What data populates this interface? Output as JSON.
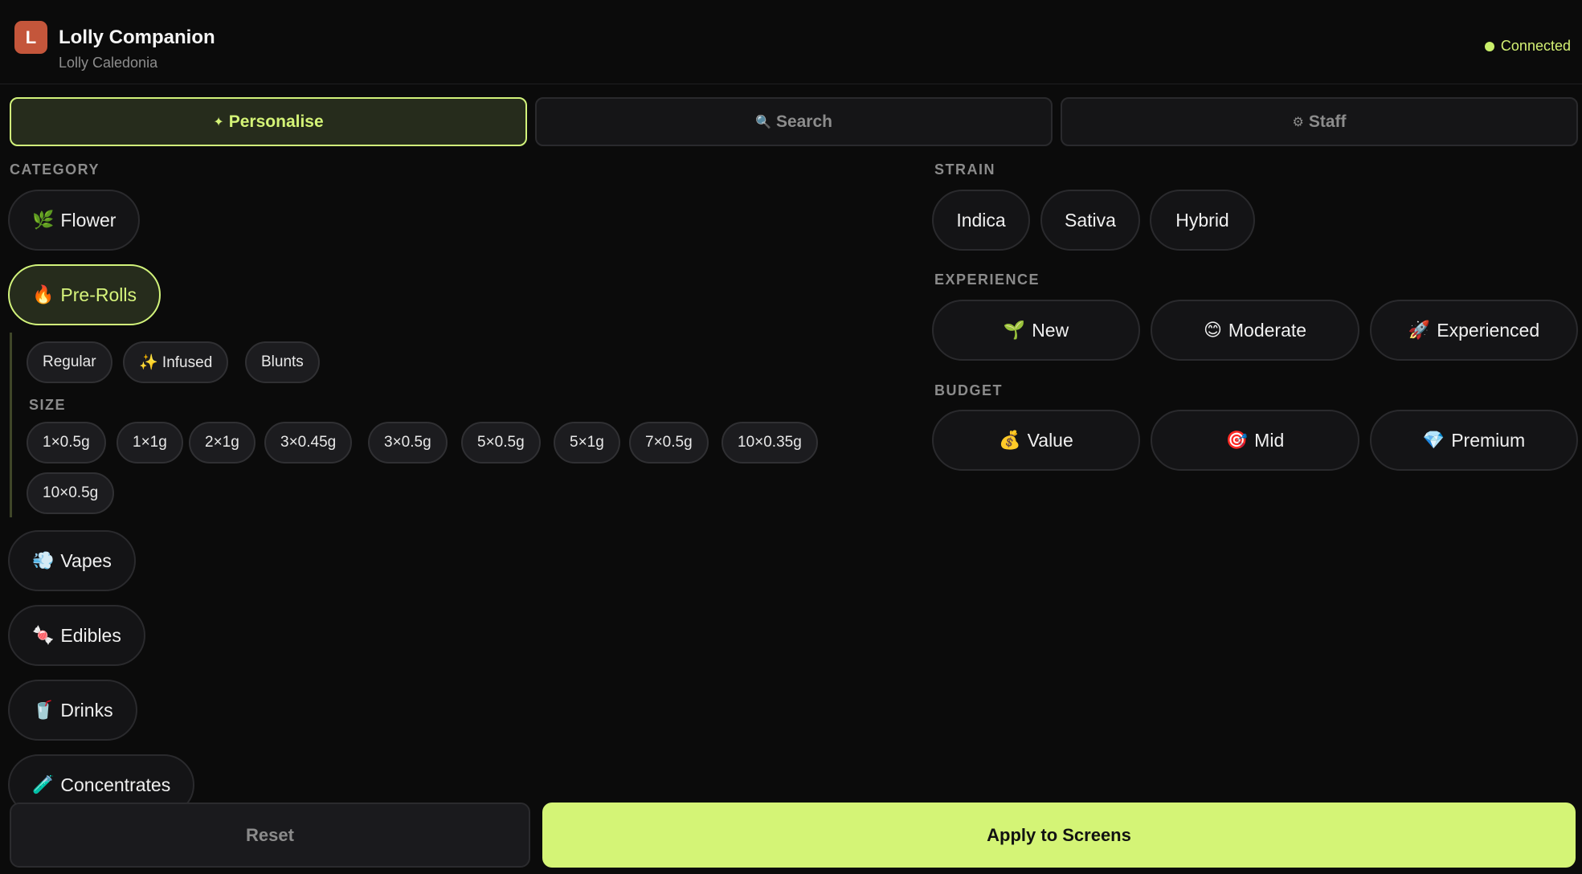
{
  "header": {
    "logo_letter": "L",
    "title": "Lolly Companion",
    "subtitle": "Lolly Caledonia",
    "status": "Connected",
    "status_color": "#c9ef6a"
  },
  "tabs": [
    {
      "icon": "✦",
      "label": "Personalise",
      "active": true
    },
    {
      "icon": "🔍",
      "label": "Search",
      "active": false
    },
    {
      "icon": "⚙",
      "label": "Staff",
      "active": false
    }
  ],
  "category": {
    "label": "CATEGORY",
    "items": [
      {
        "icon": "🌿",
        "label": "Flower"
      },
      {
        "icon": "🔥",
        "label": "Pre-Rolls",
        "active": true
      },
      {
        "icon": "💨",
        "label": "Vapes"
      },
      {
        "icon": "🍬",
        "label": "Edibles"
      },
      {
        "icon": "🥤",
        "label": "Drinks"
      },
      {
        "icon": "🧪",
        "label": "Concentrates"
      }
    ],
    "subtypes": [
      "Regular",
      "✨ Infused",
      "Blunts"
    ],
    "size_label": "SIZE",
    "sizes": [
      "1×0.5g",
      "1×1g",
      "2×1g",
      "3×0.45g",
      "3×0.5g",
      "5×0.5g",
      "5×1g",
      "7×0.5g",
      "10×0.35g",
      "10×0.5g"
    ]
  },
  "strain": {
    "label": "STRAIN",
    "items": [
      "Indica",
      "Sativa",
      "Hybrid"
    ]
  },
  "experience": {
    "label": "EXPERIENCE",
    "items": [
      {
        "icon": "🌱",
        "label": "New"
      },
      {
        "icon": "😊",
        "label": "Moderate"
      },
      {
        "icon": "🚀",
        "label": "Experienced"
      }
    ]
  },
  "budget": {
    "label": "BUDGET",
    "items": [
      {
        "icon": "💰",
        "label": "Value"
      },
      {
        "icon": "🎯",
        "label": "Mid"
      },
      {
        "icon": "💎",
        "label": "Premium"
      }
    ]
  },
  "actions": {
    "reset": "Reset",
    "apply": "Apply to Screens"
  },
  "colors": {
    "accent": "#d4f476",
    "background": "#0b0b0b"
  }
}
